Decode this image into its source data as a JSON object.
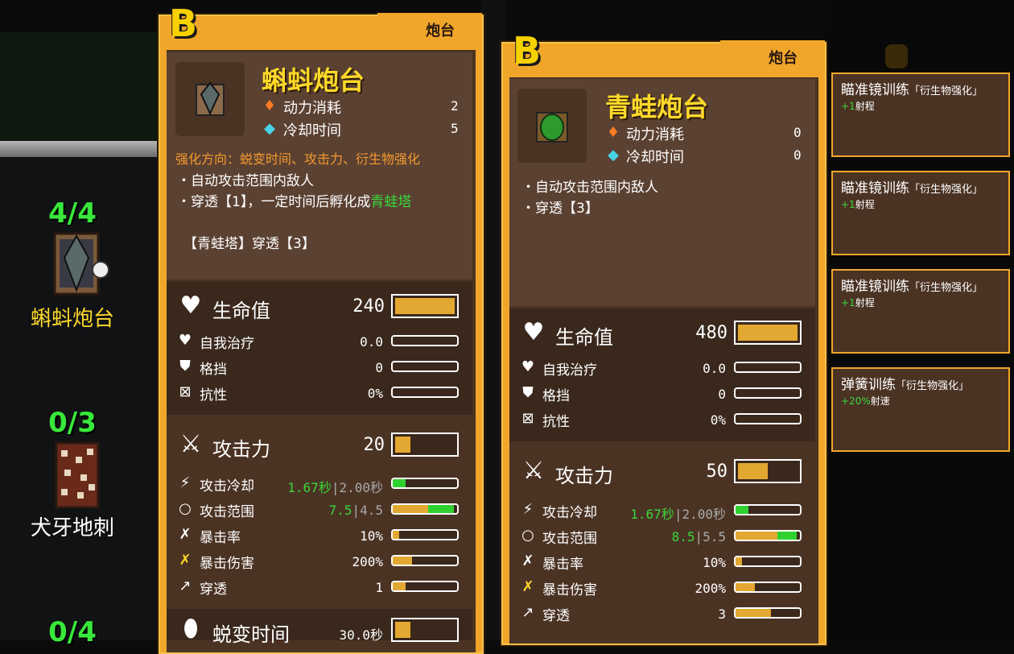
{
  "left_list": [
    {
      "count": "4/4",
      "name": "蝌蚪炮台"
    },
    {
      "count": "0/3",
      "name": "犬牙地刺"
    },
    {
      "count": "0/4",
      "name": ""
    }
  ],
  "card1": {
    "grade": "B",
    "category": "炮台",
    "name": "蝌蚪炮台",
    "power_label": "动力消耗",
    "power_value": "2",
    "cooldown_label": "冷却时间",
    "cooldown_value": "5",
    "upgrade_dir": "强化方向：蜕变时间、攻击力、衍生物强化",
    "line1": "・自动攻击范围内敌人",
    "line2_prefix": "・穿透【1】，一定时间后孵化成",
    "line2_green": "青蛙塔",
    "line3": "【青蛙塔】穿透【3】",
    "hp_label": "生命值",
    "hp_value": "240",
    "hp_fill": 1.0,
    "heal_label": "自我治疗",
    "heal_value": "0.0",
    "block_label": "格挡",
    "block_value": "0",
    "resist_label": "抗性",
    "resist_value": "0%",
    "atk_label": "攻击力",
    "atk_value": "20",
    "atk_fill": 0.25,
    "atkcd_label": "攻击冷却",
    "atkcd_green": "1.67秒",
    "atkcd_gray": "|2.00秒",
    "atkcd_fill": 0.2,
    "range_label": "攻击范围",
    "range_green": "7.5",
    "range_gray": "|4.5",
    "range_fill": 0.55,
    "range_bonus": 0.4,
    "crit_label": "暴击率",
    "crit_value": "10%",
    "crit_fill": 0.1,
    "critdmg_label": "暴击伤害",
    "critdmg_value": "200%",
    "critdmg_fill": 0.3,
    "pierce_label": "穿透",
    "pierce_value": "1",
    "pierce_fill": 0.2,
    "morph_label": "蜕变时间",
    "morph_value": "30.0秒",
    "morph_fill": 0.25
  },
  "card2": {
    "grade": "B",
    "category": "炮台",
    "name": "青蛙炮台",
    "power_label": "动力消耗",
    "power_value": "0",
    "cooldown_label": "冷却时间",
    "cooldown_value": "0",
    "line1": "・自动攻击范围内敌人",
    "line2": "・穿透【3】",
    "hp_label": "生命值",
    "hp_value": "480",
    "hp_fill": 1.0,
    "heal_label": "自我治疗",
    "heal_value": "0.0",
    "block_label": "格挡",
    "block_value": "0",
    "resist_label": "抗性",
    "resist_value": "0%",
    "atk_label": "攻击力",
    "atk_value": "50",
    "atk_fill": 0.5,
    "atkcd_label": "攻击冷却",
    "atkcd_green": "1.67秒",
    "atkcd_gray": "|2.00秒",
    "atkcd_fill": 0.2,
    "range_label": "攻击范围",
    "range_green": "8.5",
    "range_gray": "|5.5",
    "range_fill": 0.65,
    "range_bonus": 0.3,
    "crit_label": "暴击率",
    "crit_value": "10%",
    "crit_fill": 0.1,
    "critdmg_label": "暴击伤害",
    "critdmg_value": "200%",
    "critdmg_fill": 0.3,
    "pierce_label": "穿透",
    "pierce_value": "3",
    "pierce_fill": 0.55
  },
  "upgrades": [
    {
      "title": "瞄准镜训练",
      "sub": "「衍生物强化」",
      "bonus": "+1",
      "effect": "射程"
    },
    {
      "title": "瞄准镜训练",
      "sub": "「衍生物强化」",
      "bonus": "+1",
      "effect": "射程"
    },
    {
      "title": "瞄准镜训练",
      "sub": "「衍生物强化」",
      "bonus": "+1",
      "effect": "射程"
    },
    {
      "title": "弹簧训练",
      "sub": "「衍生物强化」",
      "bonus": "+20%",
      "effect": "射速"
    }
  ],
  "colors": {
    "accent": "#f0a62a",
    "title": "#ffd92a",
    "green": "#38e83a",
    "panel": "#4b3324"
  }
}
